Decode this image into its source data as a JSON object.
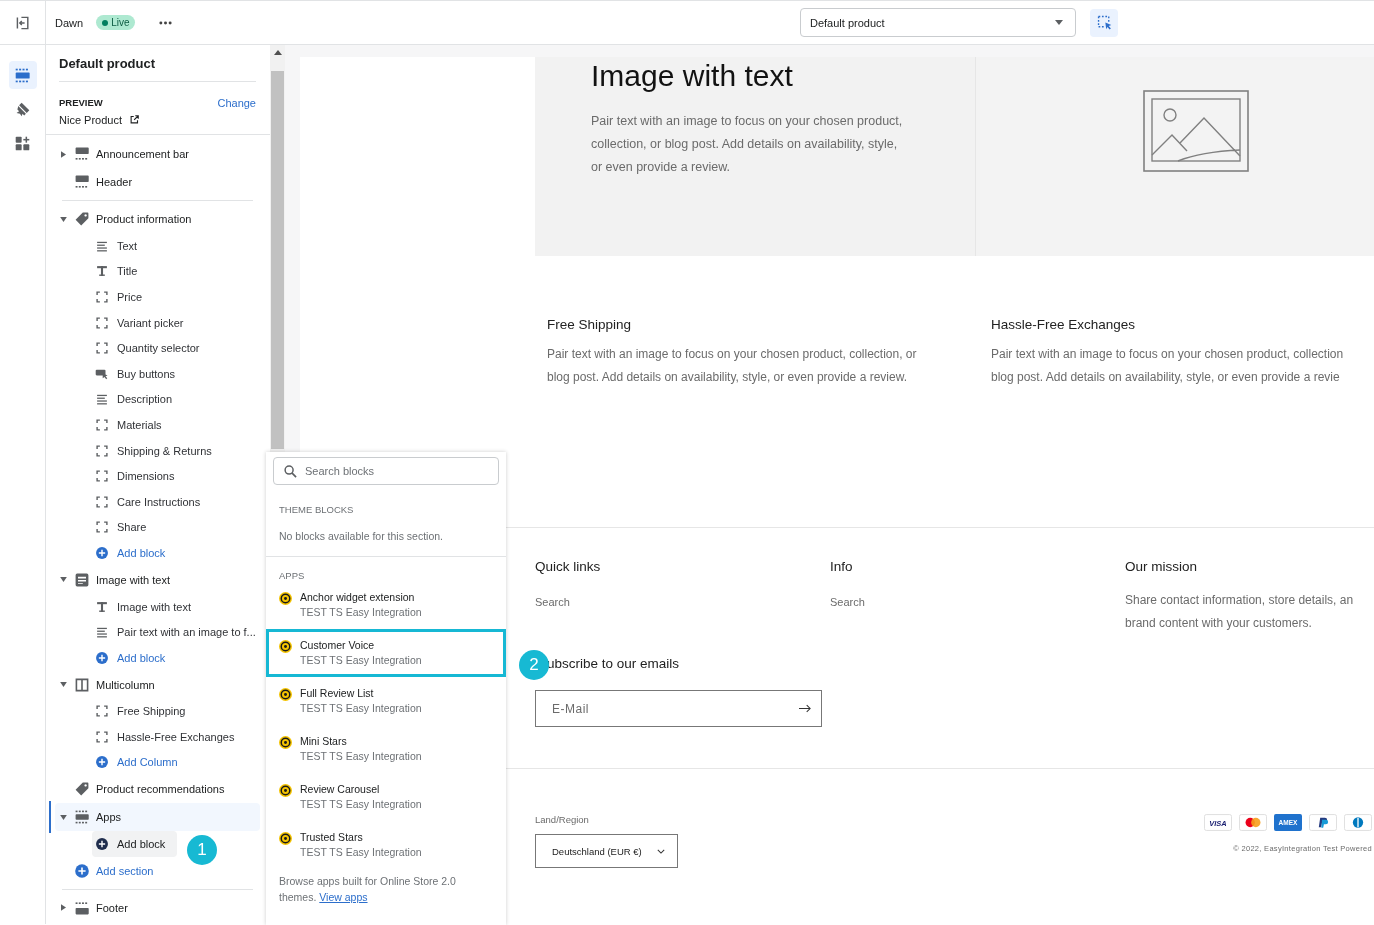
{
  "topbar": {
    "theme": "Dawn",
    "status": "Live",
    "template": "Default product",
    "inspector": {
      "active": true
    }
  },
  "rail": [
    {
      "selected": true
    },
    {
      "selected": false
    },
    {
      "selected": false
    }
  ],
  "sidebar": {
    "title": "Default product",
    "preview": {
      "label": "PREVIEW",
      "change": "Change",
      "product": "Nice Product"
    },
    "groups": [
      {
        "items": [
          {
            "kind": "header",
            "label": "Announcement bar",
            "expanded": false,
            "selected": false
          },
          {
            "kind": "header",
            "label": "Header",
            "selected": false
          }
        ]
      },
      {
        "items": [
          {
            "kind": "tag",
            "label": "Product information",
            "expanded": true,
            "selected": false,
            "children": [
              {
                "kind": "lines",
                "label": "Text",
                "selected": false
              },
              {
                "kind": "title",
                "label": "Title",
                "selected": false
              },
              {
                "kind": "bracket",
                "label": "Price",
                "selected": false
              },
              {
                "kind": "bracket",
                "label": "Variant picker",
                "selected": false
              },
              {
                "kind": "bracket",
                "label": "Quantity selector",
                "selected": false
              },
              {
                "kind": "buy",
                "label": "Buy buttons",
                "selected": false
              },
              {
                "kind": "lines",
                "label": "Description",
                "selected": false
              },
              {
                "kind": "bracket",
                "label": "Materials",
                "selected": false
              },
              {
                "kind": "bracket",
                "label": "Shipping & Returns",
                "selected": false
              },
              {
                "kind": "bracket",
                "label": "Dimensions",
                "selected": false
              },
              {
                "kind": "bracket",
                "label": "Care Instructions",
                "selected": false
              },
              {
                "kind": "bracket",
                "label": "Share",
                "selected": false
              },
              {
                "kind": "add",
                "label": "Add block",
                "selected": false
              }
            ]
          },
          {
            "kind": "doc",
            "label": "Image with text",
            "expanded": true,
            "selected": false,
            "children": [
              {
                "kind": "title",
                "label": "Image with text",
                "selected": false
              },
              {
                "kind": "lines",
                "label": "Pair text with an image to f...",
                "selected": false
              },
              {
                "kind": "add",
                "label": "Add block",
                "selected": false
              }
            ]
          },
          {
            "kind": "columns",
            "label": "Multicolumn",
            "expanded": true,
            "selected": false,
            "children": [
              {
                "kind": "bracket",
                "label": "Free Shipping",
                "selected": false
              },
              {
                "kind": "bracket",
                "label": "Hassle-Free Exchanges",
                "selected": false
              },
              {
                "kind": "add",
                "label": "Add Column",
                "selected": false
              }
            ]
          },
          {
            "kind": "tag",
            "label": "Product recommendations",
            "selected": false
          },
          {
            "kind": "appsection",
            "label": "Apps",
            "expanded": true,
            "selected": true,
            "children": [
              {
                "kind": "add",
                "label": "Add block",
                "selected": true
              }
            ]
          },
          {
            "kind": "add",
            "label": "Add section",
            "selected": false
          }
        ]
      },
      {
        "items": [
          {
            "kind": "footer",
            "label": "Footer",
            "expanded": false,
            "selected": false
          }
        ]
      }
    ]
  },
  "block_picker": {
    "search_placeholder": "Search blocks",
    "theme_heading": "THEME BLOCKS",
    "theme_empty": "No blocks available for this section.",
    "apps_heading": "APPS",
    "apps": [
      {
        "name": "Anchor widget extension",
        "developer": "TEST TS Easy Integration",
        "highlighted": false
      },
      {
        "name": "Customer Voice",
        "developer": "TEST TS Easy Integration",
        "highlighted": true
      },
      {
        "name": "Full Review List",
        "developer": "TEST TS Easy Integration",
        "highlighted": false
      },
      {
        "name": "Mini Stars",
        "developer": "TEST TS Easy Integration",
        "highlighted": false
      },
      {
        "name": "Review Carousel",
        "developer": "TEST TS Easy Integration",
        "highlighted": false
      },
      {
        "name": "Trusted Stars",
        "developer": "TEST TS Easy Integration",
        "highlighted": false
      }
    ],
    "footer_text": "Browse apps built for Online Store 2.0 themes.",
    "footer_link": "View apps"
  },
  "preview": {
    "image_with_text": {
      "heading": "Image with text",
      "lines": [
        "Pair text with an image to focus on your chosen product,",
        "collection, or blog post. Add details on availability, style,",
        "or even provide a review."
      ]
    },
    "multicolumn": [
      {
        "title": "Free Shipping",
        "lines": [
          "Pair text with an image to focus on your chosen product, collection, or",
          "blog post. Add details on availability, style, or even provide a review."
        ]
      },
      {
        "title": "Hassle-Free Exchanges",
        "lines": [
          "Pair text with an image to focus on your chosen product, collection",
          "blog post. Add details on availability, style, or even provide a revie"
        ]
      }
    ],
    "footer": {
      "columns": [
        {
          "heading": "Quick links",
          "links": [
            "Search"
          ]
        },
        {
          "heading": "Info",
          "links": [
            "Search"
          ]
        },
        {
          "heading": "Our mission",
          "lines": [
            "Share contact information, store details, an",
            "brand content with your customers."
          ]
        }
      ],
      "newsletter": {
        "heading": "ubscribe to our emails",
        "placeholder": "E-Mail"
      },
      "region": {
        "label": "Land/Region",
        "value": "Deutschland (EUR €)"
      },
      "payments": [
        {
          "kind": "visa",
          "label": "VISA"
        },
        {
          "kind": "mastercard"
        },
        {
          "kind": "amex",
          "label": "AMEX"
        },
        {
          "kind": "paypal"
        },
        {
          "kind": "diners"
        }
      ],
      "copyright": "© 2022, EasyIntegration Test Powered"
    }
  },
  "annotations": [
    {
      "number": "1"
    },
    {
      "number": "2"
    }
  ]
}
